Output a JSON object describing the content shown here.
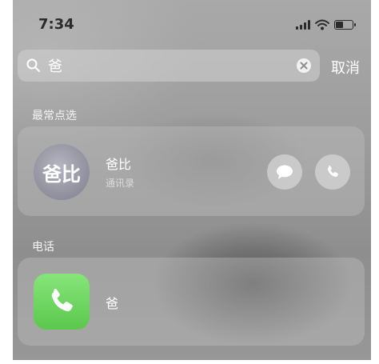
{
  "status_bar": {
    "time": "7:34"
  },
  "search": {
    "query": "爸",
    "cancel_label": "取消"
  },
  "sections": {
    "top_hits": {
      "label": "最常点选",
      "contact": {
        "avatar_text": "爸比",
        "name": "爸比",
        "source": "通讯录"
      }
    },
    "phone": {
      "label": "电话",
      "result": {
        "name": "爸"
      }
    }
  },
  "icons": [
    "search-icon",
    "clear-icon",
    "message-icon",
    "phone-icon",
    "phone-app-icon"
  ],
  "colors": {
    "phone_app": "#5bc84d"
  }
}
